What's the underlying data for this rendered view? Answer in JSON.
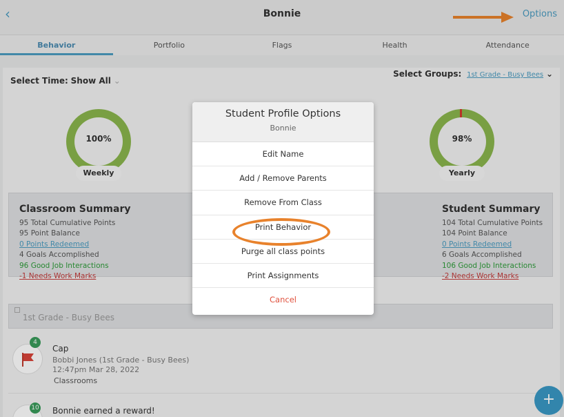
{
  "header": {
    "back_icon": "chevron-left-icon",
    "title": "Bonnie",
    "options_label": "Options"
  },
  "tabs": [
    {
      "label": "Behavior",
      "active": true
    },
    {
      "label": "Portfolio",
      "active": false
    },
    {
      "label": "Flags",
      "active": false
    },
    {
      "label": "Health",
      "active": false
    },
    {
      "label": "Attendance",
      "active": false
    }
  ],
  "filters": {
    "select_time_label": "Select Time:",
    "select_time_value": "Show All",
    "select_groups_label": "Select Groups:",
    "select_groups_value": "1st Grade - Busy Bees"
  },
  "gauges": {
    "weekly": {
      "value": "100%",
      "label": "Weekly",
      "fraction": 1.0
    },
    "yearly": {
      "value": "98%",
      "label": "Yearly",
      "fraction": 0.98
    }
  },
  "classroom_summary": {
    "title": "Classroom Summary",
    "total_points": "95 Total Cumulative Points",
    "point_balance": "95 Point Balance",
    "redeemed": "0 Points Redeemed",
    "goals": "4 Goals Accomplished",
    "good_job": "96 Good Job Interactions",
    "needs_work": "-1 Needs Work Marks"
  },
  "student_summary": {
    "title": "Student Summary",
    "total_points": "104 Total Cumulative Points",
    "point_balance": "104 Point Balance",
    "redeemed": "0 Points Redeemed",
    "goals": "6 Goals Accomplished",
    "good_job": "106 Good Job Interactions",
    "needs_work": "-2 Needs Work Marks"
  },
  "group_bar": {
    "label": "1st Grade - Busy Bees"
  },
  "feed": [
    {
      "badge": "4",
      "title": "Cap",
      "meta1": "Bobbi Jones (1st Grade - Busy Bees)",
      "meta2": "12:47pm Mar 28, 2022",
      "tag": "Classrooms"
    },
    {
      "badge": "10",
      "title": "Bonnie earned a reward!"
    }
  ],
  "modal": {
    "title": "Student Profile Options",
    "subtitle": "Bonnie",
    "items": [
      "Edit Name",
      "Add / Remove Parents",
      "Remove From Class",
      "Print Behavior",
      "Purge all class points",
      "Print Assignments"
    ],
    "cancel_label": "Cancel"
  },
  "colors": {
    "accent": "#4a9bc0",
    "gauge": "#8ab54d",
    "highlight": "#e8822c",
    "cancel": "#e0503c"
  }
}
